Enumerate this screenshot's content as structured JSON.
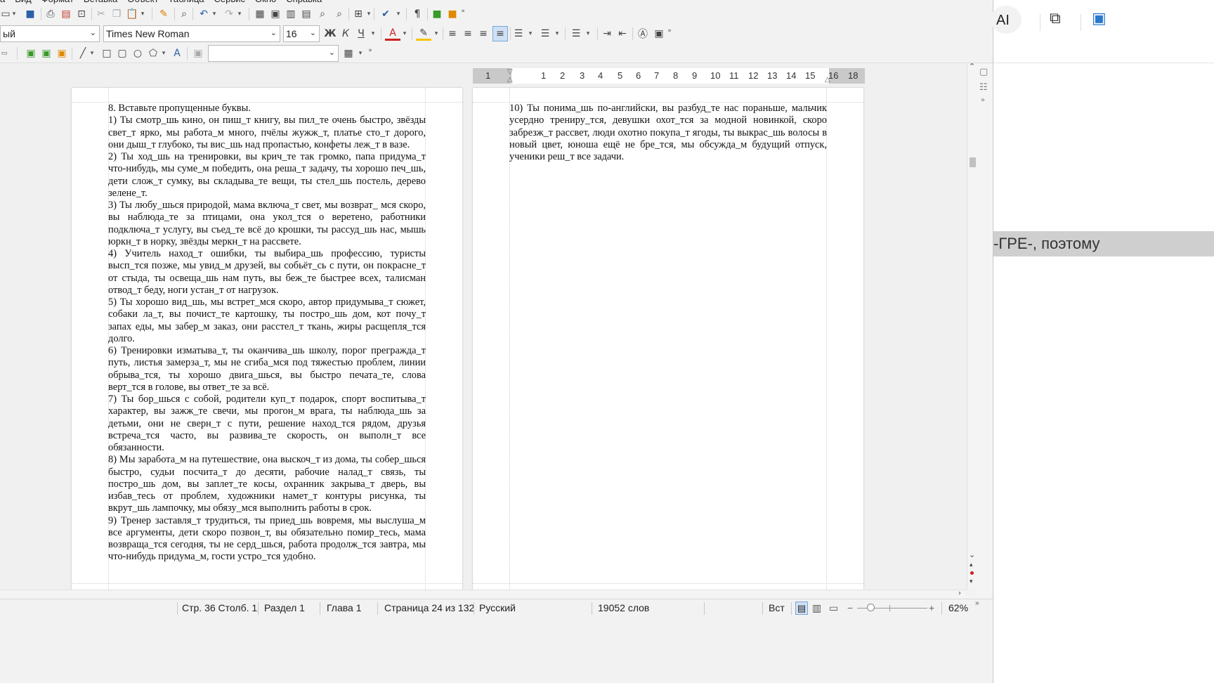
{
  "menu": [
    "ка",
    "Вид",
    "Формат",
    "Вставка",
    "Объект",
    "Таблица",
    "Сервис",
    "Окно",
    "Справка"
  ],
  "formatting": {
    "paragraph_style": "ый",
    "font_name": "Times New Roman",
    "font_size": "16",
    "bold": "Ж",
    "italic": "К",
    "underline": "Ч",
    "font_color_letter": "A",
    "highlight_color": "#f4c400",
    "font_color": "#d02020"
  },
  "ruler": {
    "numbers": [
      "1",
      "1",
      "2",
      "3",
      "4",
      "5",
      "6",
      "7",
      "8",
      "9",
      "10",
      "11",
      "12",
      "13",
      "14",
      "15",
      "16",
      "18"
    ]
  },
  "page_left": {
    "heading": "8. Вставьте пропущенные буквы.",
    "paragraphs": [
      "1) Ты смотр_шь кино, он пиш_т книгу, вы пил_те очень быстро, звёзды свет_т ярко, мы работа_м много, пчёлы жужж_т, платье сто_т дорого, они дыш_т глубоко, ты вис_шь над пропастью, конфеты леж_т в вазе.",
      "2) Ты ход_шь на тренировки, вы крич_те так громко, папа придума_т что-нибудь, мы суме_м победить, она реша_т задачу, ты хорошо печ_шь, дети слож_т сумку, вы складыва_те вещи, ты стел_шь постель, дерево зелене_т.",
      "3) Ты любу_шься природой, мама включа_т свет, мы возврат_ мся скоро, вы наблюда_те за птицами, она укол_тся о веретено, работники подключа_т услугу, вы съед_те всё до крошки, ты рассуд_шь нас, мышь юркн_т в норку, звёзды меркн_т на рассвете.",
      "4) Учитель наход_т ошибки, ты выбира_шь профессию, туристы высп_тся позже, мы увид_м друзей, вы собьёт_сь с пути, он покрасне_т от стыда, ты освеща_шь нам путь, вы беж_те быстрее всех, талисман отвод_т беду, ноги устан_т от нагрузок.",
      "5) Ты хорошо вид_шь, мы встрет_мся скоро, автор придумыва_т сюжет, собаки ла_т, вы почист_те картошку, ты постро_шь дом, кот почу_т запах еды, мы забер_м заказ, они расстел_т ткань, жиры расщепля_тся долго.",
      "6) Тренировки изматыва_т, ты оканчива_шь школу, порог прегражда_т путь, листья замерза_т, мы не сгиба_мся под тяжестью проблем, линии обрыва_тся, ты хорошо двига_шься, вы быстро печата_те, слова верт_тся в голове, вы ответ_те за всё.",
      "7) Ты бор_шься с собой, родители куп_т подарок, спорт воспитыва_т характер, вы зажж_те свечи, мы прогон_м врага, ты наблюда_шь за детьми, они не сверн_т с пути, решение наход_тся рядом, друзья встреча_тся часто, вы развива_те скорость, он выполн_т все обязанности.",
      "8) Мы заработа_м на путешествие, она выскоч_т из дома, ты собер_шься быстро, судьи посчита_т до десяти, рабочие налад_т связь, ты постро_шь дом, вы заплет_те косы, охранник закрыва_т дверь, вы избав_тесь от проблем, художники намет_т контуры рисунка, ты вкрут_шь лампочку, мы обязу_мся выполнить работы в срок.",
      "9) Тренер заставля_т трудиться, ты приед_шь вовремя, мы выслуша_м все аргументы, дети скоро позвон_т, вы обязательно помир_тесь, мама возвраща_тся сегодня, ты не серд_шься, работа продолж_тся завтра, мы что-нибудь придума_м, гости устро_тся удобно."
    ]
  },
  "page_right": {
    "paragraphs": [
      "10) Ты понима_шь по-английски, вы разбуд_те нас пораньше, мальчик усердно трениру_тся, девушки охот_тся за модной новинкой, скоро забрезж_т рассвет, люди охотно покупа_т ягоды, ты выкрас_шь волосы в новый цвет, юноша ещё не бре_тся, мы обсужда_м будущий отпуск, ученики реш_т все задачи."
    ]
  },
  "status": {
    "position": "Стр. 36 Столб. 1",
    "section": "Раздел 1",
    "chapter": "Глава 1",
    "page": "Страница 24 из 132",
    "language": "Русский",
    "words": "19052 слов",
    "insert_mode": "Вст",
    "zoom": "62%",
    "zoom_minus": "−",
    "zoom_plus": "+"
  },
  "right_panel": {
    "ai_label": "AI",
    "caption": "-ГРЕ-, поэтому"
  }
}
